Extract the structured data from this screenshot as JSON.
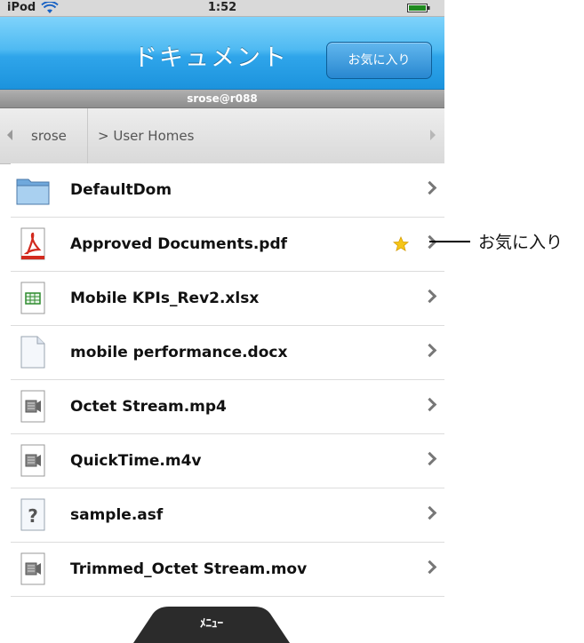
{
  "status": {
    "carrier": "iPod",
    "time": "1:52"
  },
  "nav": {
    "title": "ドキュメント",
    "favorites_button": "お気に入り"
  },
  "user": {
    "account": "srose@r088"
  },
  "breadcrumb": {
    "items": [
      "srose",
      "> User Homes"
    ]
  },
  "files": [
    {
      "name": "DefaultDom",
      "icon": "folder-icon",
      "favorite": false
    },
    {
      "name": "Approved Documents.pdf",
      "icon": "pdf-icon",
      "favorite": true
    },
    {
      "name": "Mobile KPIs_Rev2.xlsx",
      "icon": "spreadsheet-icon",
      "favorite": false
    },
    {
      "name": "mobile performance.docx",
      "icon": "document-icon",
      "favorite": false
    },
    {
      "name": "Octet Stream.mp4",
      "icon": "video-icon",
      "favorite": false
    },
    {
      "name": "QuickTime.m4v",
      "icon": "video-icon",
      "favorite": false
    },
    {
      "name": "sample.asf",
      "icon": "unknown-file-icon",
      "favorite": false
    },
    {
      "name": "Trimmed_Octet Stream.mov",
      "icon": "video-icon",
      "favorite": false
    }
  ],
  "menu": {
    "label": "ﾒﾆｭｰ"
  },
  "callout": {
    "label": "お気に入り"
  },
  "colors": {
    "nav_blue": "#2fa5ea",
    "star_yellow": "#f5c518",
    "pdf_red": "#d22a1e",
    "xlsx_green": "#2e8b2e"
  }
}
